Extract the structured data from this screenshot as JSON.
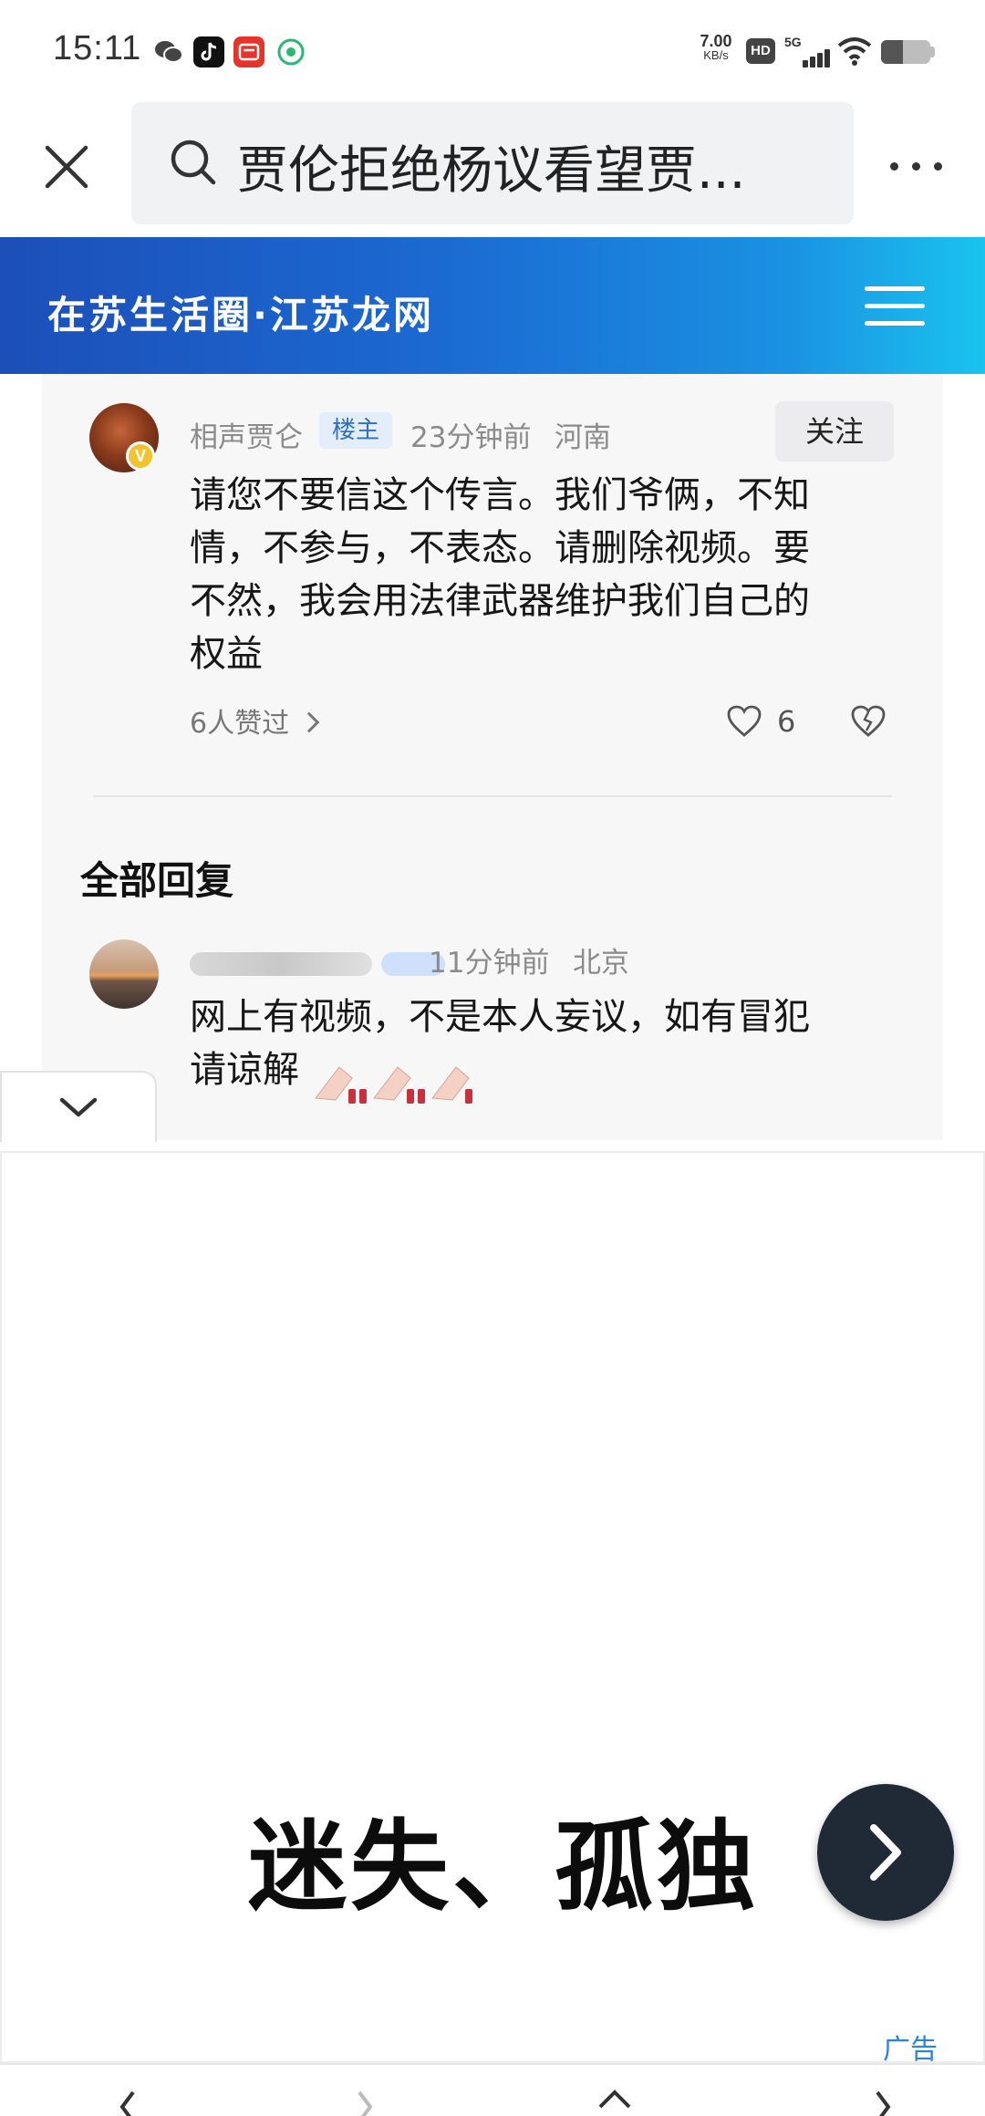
{
  "status_bar": {
    "time": "15:11",
    "net_speed_value": "7.00",
    "net_speed_unit": "KB/s",
    "hd_label": "HD",
    "network_label": "5G",
    "battery_level": 0.45,
    "app_icons": [
      "wechat-icon",
      "douyin-icon",
      "taobao-icon",
      "green-app-icon"
    ]
  },
  "browser": {
    "search_text": "贾伦拒绝杨议看望贾..."
  },
  "site": {
    "title": "在苏生活圈·江苏龙网"
  },
  "comment": {
    "author": "相声贾仑",
    "author_badge": "V",
    "op_badge": "楼主",
    "time": "23分钟前",
    "location": "河南",
    "follow_label": "关注",
    "body_lines": [
      "请您不要信这个传言。我们爷俩，不知",
      "情，不参与，不表态。请删除视频。要",
      "不然，我会用法律武器维护我们自己的",
      "权益"
    ],
    "likers_text": "6人赞过",
    "like_count": "6"
  },
  "replies": {
    "section_title": "全部回复",
    "items": [
      {
        "time": "11分钟前",
        "location": "北京",
        "body_lines": [
          "网上有视频，不是本人妄议，如有冒犯",
          "请谅解"
        ]
      }
    ]
  },
  "ad": {
    "headline": "迷失、孤独",
    "label": "广告"
  },
  "colors": {
    "header_gradient_start": "#1c4fb8",
    "header_gradient_end": "#19c3ee",
    "op_badge_text": "#2e6fc6",
    "ad_label": "#2a85d8",
    "ad_arrow_bg": "#1f2a36"
  }
}
